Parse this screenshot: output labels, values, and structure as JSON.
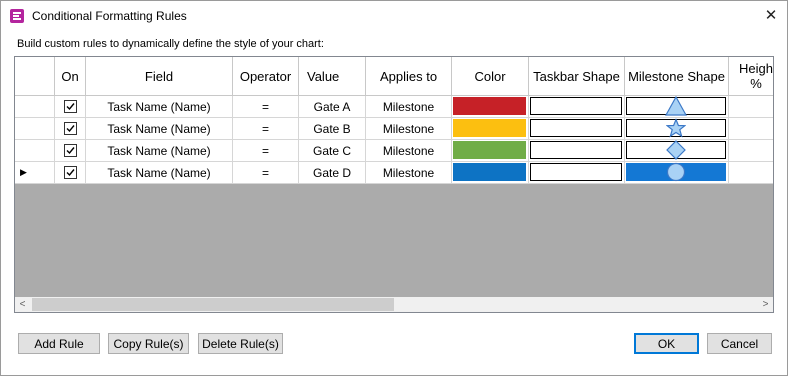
{
  "window": {
    "title": "Conditional Formatting Rules"
  },
  "description": "Build custom rules to dynamically define the style of your chart:",
  "columns": [
    {
      "key": "on",
      "label": "On"
    },
    {
      "key": "field",
      "label": "Field"
    },
    {
      "key": "operator",
      "label": "Operator"
    },
    {
      "key": "value",
      "label": "Value"
    },
    {
      "key": "applies_to",
      "label": "Applies to"
    },
    {
      "key": "color",
      "label": "Color"
    },
    {
      "key": "taskbar_shape",
      "label": "Taskbar Shape"
    },
    {
      "key": "milestone_shape",
      "label": "Milestone Shape"
    },
    {
      "key": "height",
      "label": "Heigh %"
    }
  ],
  "rows": [
    {
      "on": true,
      "field": "Task Name (Name)",
      "operator": "=",
      "value": "Gate A",
      "applies_to": "Milestone",
      "color": "#c62127",
      "milestone_shape": "triangle",
      "selected": false
    },
    {
      "on": true,
      "field": "Task Name (Name)",
      "operator": "=",
      "value": "Gate B",
      "applies_to": "Milestone",
      "color": "#fcbf10",
      "milestone_shape": "star",
      "selected": false
    },
    {
      "on": true,
      "field": "Task Name (Name)",
      "operator": "=",
      "value": "Gate C",
      "applies_to": "Milestone",
      "color": "#70ad47",
      "milestone_shape": "diamond",
      "selected": false
    },
    {
      "on": true,
      "field": "Task Name (Name)",
      "operator": "=",
      "value": "Gate D",
      "applies_to": "Milestone",
      "color": "#0d73c4",
      "milestone_shape": "circle",
      "selected": true
    }
  ],
  "shape_fill": "#a9d2f5",
  "shape_stroke": "#3b78c7",
  "buttons": {
    "add_rule": "Add Rule",
    "copy_rules": "Copy Rule(s)",
    "delete_rules": "Delete Rule(s)",
    "ok": "OK",
    "cancel": "Cancel"
  }
}
